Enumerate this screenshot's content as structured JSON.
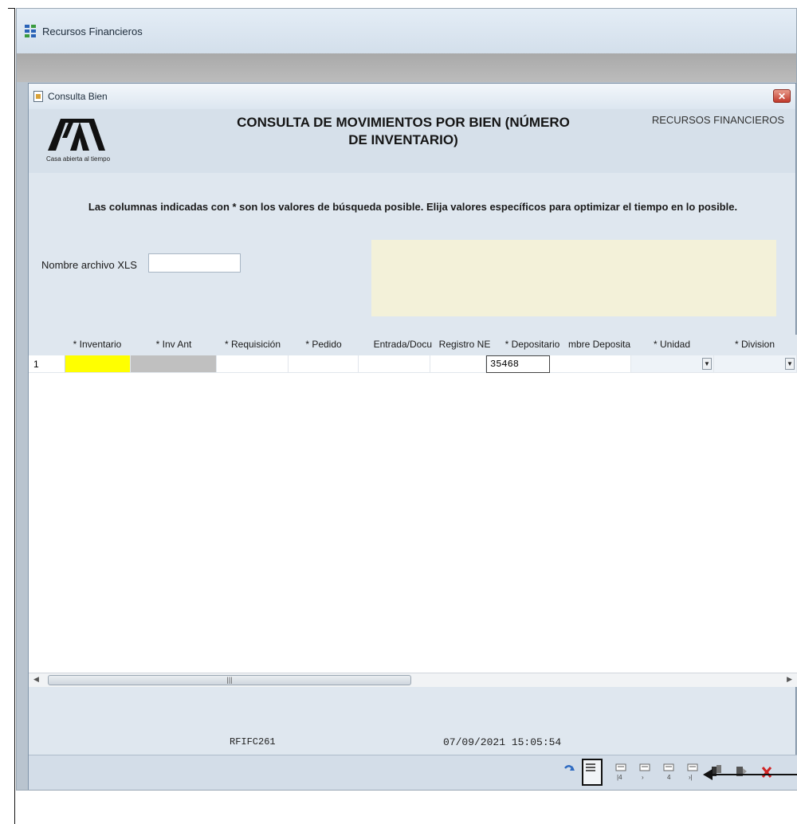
{
  "app": {
    "title": "Recursos Financieros"
  },
  "dialog": {
    "title": "Consulta Bien",
    "close_glyph": "✕",
    "main_title_line1": "CONSULTA DE MOVIMIENTOS POR BIEN (NÚMERO",
    "main_title_line2": "DE INVENTARIO)",
    "org_label": "RECURSOS FINANCIEROS",
    "logo_tagline": "Casa abierta al tiempo",
    "instructions": "Las columnas indicadas con * son los valores de búsqueda posible.  Elija valores específicos para optimizar el tiempo en lo posible.",
    "xls_label": "Nombre archivo XLS",
    "xls_value": ""
  },
  "grid": {
    "columns": [
      "* Inventario",
      "* Inv Ant",
      "* Requisición",
      "* Pedido",
      "Entrada/Docu",
      "Registro NE",
      "* Depositario",
      "mbre Deposita",
      "* Unidad",
      "* Division"
    ],
    "rows": [
      {
        "num": "1",
        "depositario": "35468"
      }
    ]
  },
  "footer": {
    "code": "RFIFC261",
    "timestamp": "07/09/2021 15:05:54"
  },
  "toolbar": {
    "icons": [
      "refresh-icon",
      "report-icon",
      "first-record-icon",
      "prev-record-icon",
      "next-record-icon",
      "last-record-icon",
      "export-icon",
      "exit-view-icon",
      "close-icon"
    ]
  },
  "colors": {
    "inventario_cell": "#ffff00",
    "inv_ant_cell": "#c0c0c0",
    "note_box": "#f3f1d9"
  }
}
